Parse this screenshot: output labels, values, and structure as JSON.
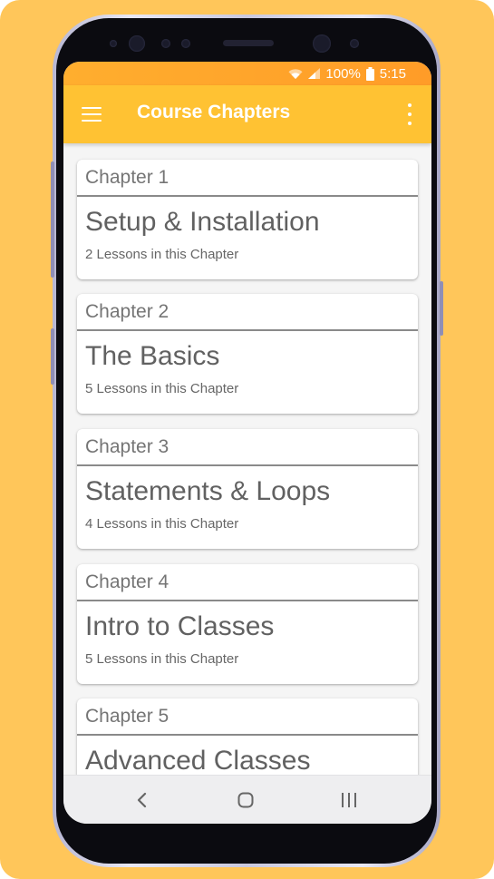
{
  "status_bar": {
    "battery": "100%",
    "time": "5:15",
    "icons": [
      "wifi-icon",
      "signal-icon",
      "battery-icon"
    ]
  },
  "app_bar": {
    "title": "Course Chapters",
    "menu_icon": "hamburger-menu-icon",
    "more_icon": "more-vertical-icon"
  },
  "chapters": [
    {
      "label": "Chapter 1",
      "title": "Setup & Installation",
      "lessons": "2 Lessons in this Chapter"
    },
    {
      "label": "Chapter 2",
      "title": "The Basics",
      "lessons": "5 Lessons in this Chapter"
    },
    {
      "label": "Chapter 3",
      "title": "Statements & Loops",
      "lessons": "4 Lessons in this Chapter"
    },
    {
      "label": "Chapter 4",
      "title": "Intro to Classes",
      "lessons": "5 Lessons in this Chapter"
    },
    {
      "label": "Chapter 5",
      "title": "Advanced Classes",
      "lessons": ""
    }
  ],
  "nav_bar": {
    "icons": [
      "back-icon",
      "home-icon",
      "recents-icon"
    ]
  },
  "colors": {
    "background": "#FFC65A",
    "app_bar": "#FFC233",
    "status_bar": "#FFA82C"
  }
}
